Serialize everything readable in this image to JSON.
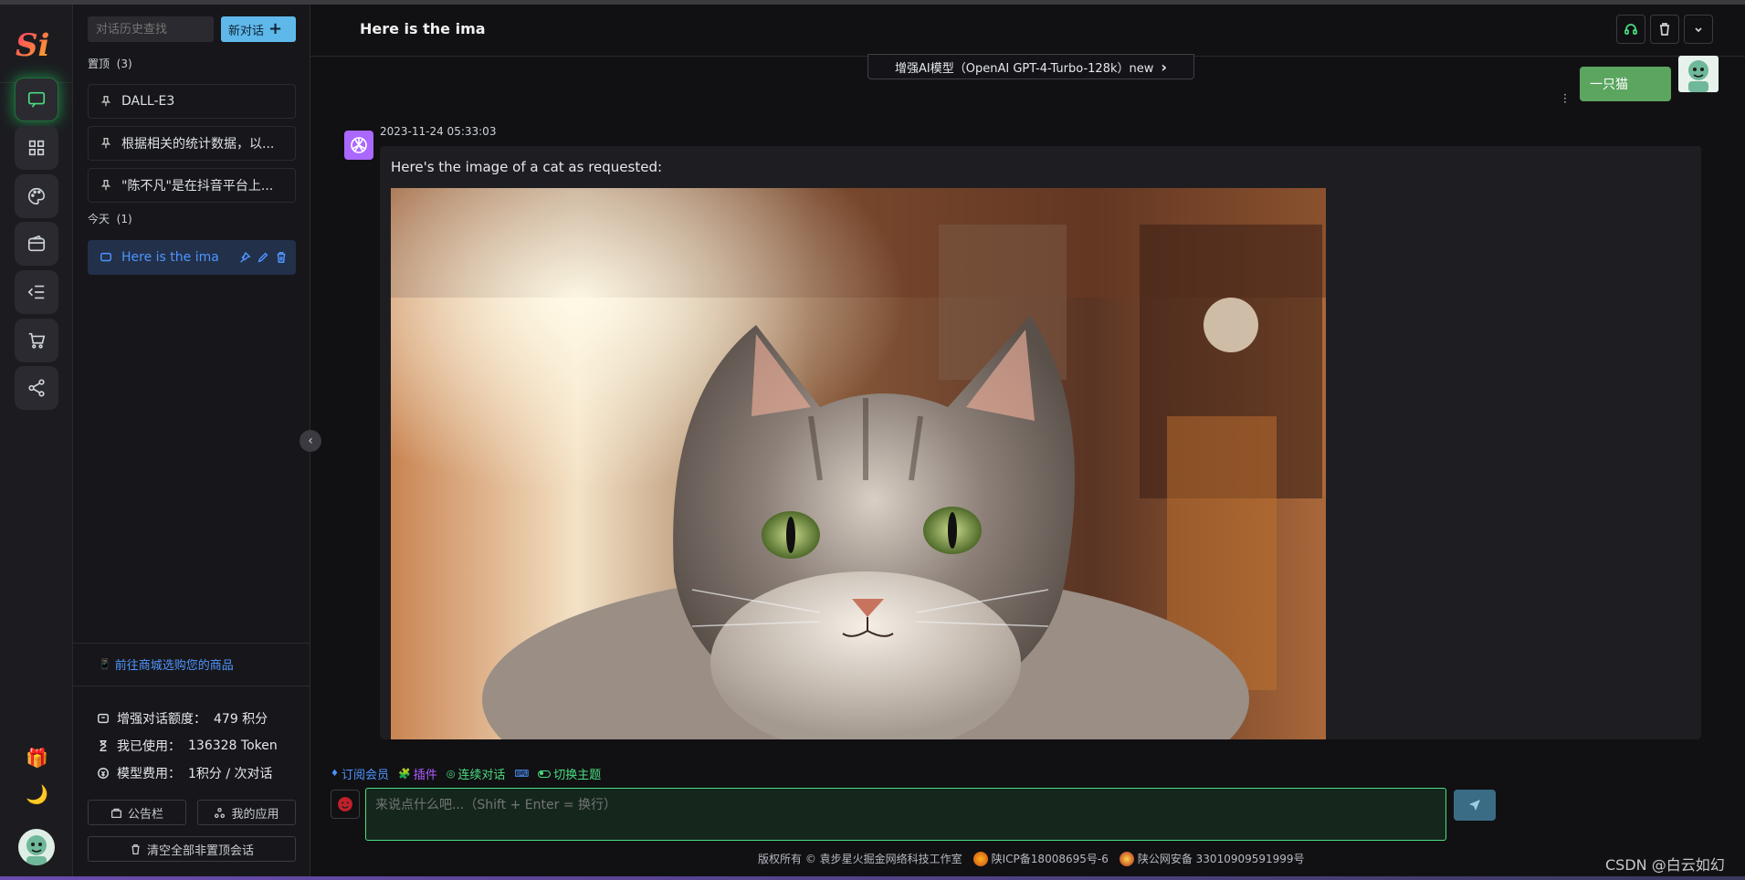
{
  "rail": {
    "logo_text": "Si",
    "nav_items": [
      "chat",
      "apps",
      "palette",
      "wallet",
      "menu-list",
      "cart",
      "share"
    ],
    "gift": "🎁",
    "moon": "🌙"
  },
  "sidebar": {
    "search_placeholder": "对话历史查找",
    "new_chat_label": "新对话",
    "pinned_title": "置顶",
    "pinned_count": "(3)",
    "pinned_items": [
      {
        "label": "DALL-E3"
      },
      {
        "label": "根据相关的统计数据，以..."
      },
      {
        "label": "\"陈不凡\"是在抖音平台上..."
      }
    ],
    "today_title": "今天",
    "today_count": "(1)",
    "today_items": [
      {
        "label": "Here is the ima"
      }
    ],
    "shop_link": "前往商城选购您的商品",
    "stats": [
      {
        "label": "增强对话额度：",
        "value": "479 积分"
      },
      {
        "label": "我已使用：",
        "value": "136328 Token"
      },
      {
        "label": "模型费用：",
        "value": "1积分 / 次对话"
      }
    ],
    "notice_button": "公告栏",
    "apps_button": "我的应用",
    "clear_button": "清空全部非置顶会话"
  },
  "header": {
    "title": "Here is the ima",
    "model_label": "增强AI模型（OpenAI GPT-4-Turbo-128k）new"
  },
  "conversation": {
    "user_message": "一只猫",
    "bot_timestamp": "2023-11-24 05:33:03",
    "bot_text": "Here's the image of a cat as requested:"
  },
  "composer": {
    "toolbar": [
      {
        "label": "订阅会员",
        "color": "#4f95ff"
      },
      {
        "label": "插件",
        "color": "#b05cff"
      },
      {
        "label": "连续对话",
        "color": "#4ade80"
      },
      {
        "label": "切换主题",
        "color": "#4ade80"
      }
    ],
    "placeholder": "来说点什么吧...（Shift + Enter = 换行）"
  },
  "footer": {
    "copyright": "版权所有 © 袁步星火掘金网络科技工作室",
    "icp": "陕ICP备18008695号-6",
    "police": "陕公网安备 33010909591999号"
  },
  "watermark": "CSDN @白云如幻",
  "colors": {
    "accent_green": "#4ade80",
    "accent_blue": "#4f95ff",
    "new_chat_bg": "#5fb8ea",
    "user_bubble": "#5ba55f"
  }
}
